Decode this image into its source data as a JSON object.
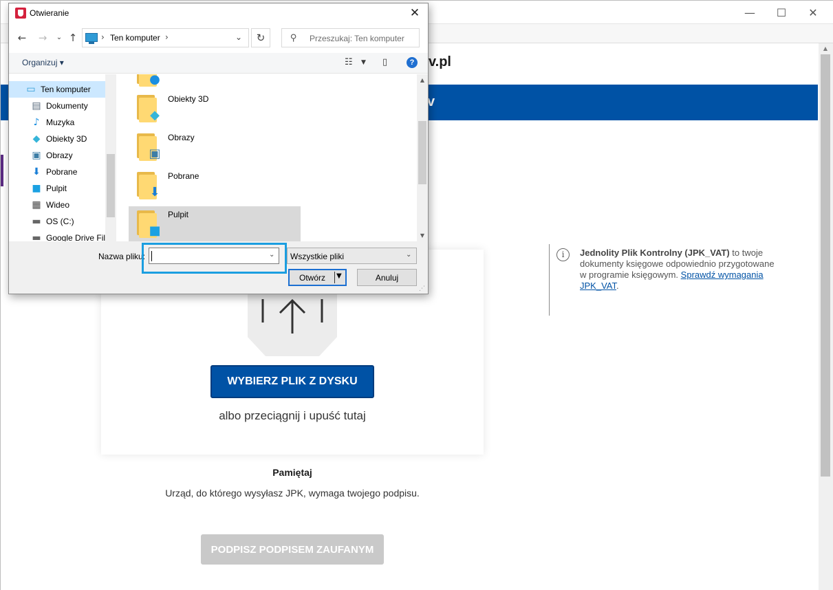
{
  "background": {
    "window_controls": {
      "minimize": "—",
      "maximize": "☐",
      "close": "✕"
    },
    "site_logo_fragment": "v.pl",
    "banner_fragment": "v",
    "info": {
      "bold": "Jednolity Plik Kontrolny (JPK_VAT)",
      "text": " to twoje dokumenty księgowe odpowiednio przygotowane w programie księgowym.",
      "link": "Sprawdź wymagania JPK_VAT",
      "after_link": "."
    },
    "upload": {
      "choose_button": "WYBIERZ PLIK Z DYSKU",
      "drop_text": "albo przeciągnij i upuść tutaj"
    },
    "remember_title": "Pamiętaj",
    "remember_text": "Urząd, do którego wysyłasz JPK, wymaga twojego podpisu.",
    "sign_button": "PODPISZ PODPISEM ZAUFANYM",
    "colors": {
      "brand_blue": "#0052a5",
      "disabled_gray": "#c9c9c9"
    }
  },
  "dialog": {
    "title": "Otwieranie",
    "breadcrumb": {
      "location": "Ten komputer"
    },
    "search_placeholder": "Przeszukaj: Ten komputer",
    "toolbar": {
      "organize": "Organizuj ▾"
    },
    "tree": [
      {
        "label": "Ten komputer",
        "icon": "pc-icon",
        "selected": true
      },
      {
        "label": "Dokumenty",
        "icon": "documents-icon"
      },
      {
        "label": "Muzyka",
        "icon": "music-icon"
      },
      {
        "label": "Obiekty 3D",
        "icon": "3d-objects-icon"
      },
      {
        "label": "Obrazy",
        "icon": "pictures-icon"
      },
      {
        "label": "Pobrane",
        "icon": "downloads-icon"
      },
      {
        "label": "Pulpit",
        "icon": "desktop-icon"
      },
      {
        "label": "Wideo",
        "icon": "video-icon"
      },
      {
        "label": "OS (C:)",
        "icon": "drive-icon"
      },
      {
        "label": "Google Drive File",
        "icon": "google-drive-icon"
      }
    ],
    "files": [
      {
        "label": "Obiekty 3D",
        "icon": "3d-objects-folder-icon"
      },
      {
        "label": "Obrazy",
        "icon": "pictures-folder-icon"
      },
      {
        "label": "Pobrane",
        "icon": "downloads-folder-icon"
      },
      {
        "label": "Pulpit",
        "icon": "desktop-folder-icon",
        "selected": true
      }
    ],
    "filename_label": "Nazwa pliku:",
    "filename_value": "",
    "filter_value": "Wszystkie pliki",
    "open_button": "Otwórz",
    "cancel_button": "Anuluj"
  }
}
